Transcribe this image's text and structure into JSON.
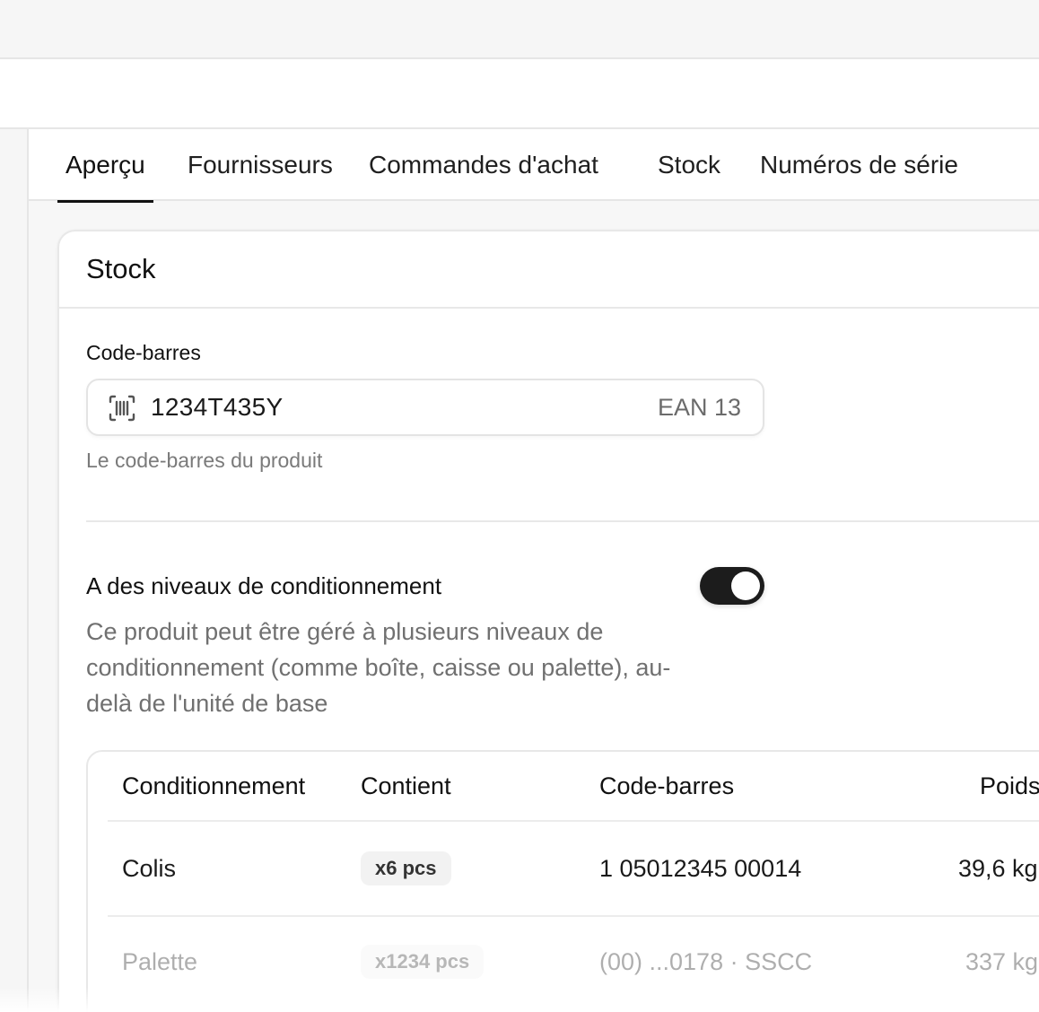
{
  "tabs": [
    {
      "label": "Aperçu",
      "active": true
    },
    {
      "label": "Fournisseurs",
      "active": false
    },
    {
      "label": "Commandes d'achat",
      "active": false
    },
    {
      "label": "Stock",
      "active": false
    },
    {
      "label": "Numéros de série",
      "active": false
    }
  ],
  "card": {
    "title": "Stock",
    "barcode": {
      "label": "Code-barres",
      "value": "1234T435Y",
      "type": "EAN 13",
      "helper": "Le code-barres du produit",
      "icon": "barcode-icon"
    },
    "packaging": {
      "title": "A des niveaux de conditionnement",
      "description": "Ce produit peut être géré à plusieurs niveaux de conditionnement (comme boîte, caisse ou palette), au-delà de l'unité de base",
      "enabled": true
    },
    "table": {
      "headers": [
        "Conditionnement",
        "Contient",
        "Code-barres",
        "Poids"
      ],
      "rows": [
        {
          "name": "Colis",
          "contains": "x6 pcs",
          "barcode": "1 05012345 00014",
          "weight": "39,6 kg"
        },
        {
          "name": "Palette",
          "contains": "x1234 pcs",
          "barcode": "(00) ...0178 · SSCC",
          "weight": "337 kg"
        }
      ]
    }
  },
  "colors": {
    "accent": "#1c1c1c",
    "border": "#e8e8e8",
    "muted_text": "#707070"
  }
}
